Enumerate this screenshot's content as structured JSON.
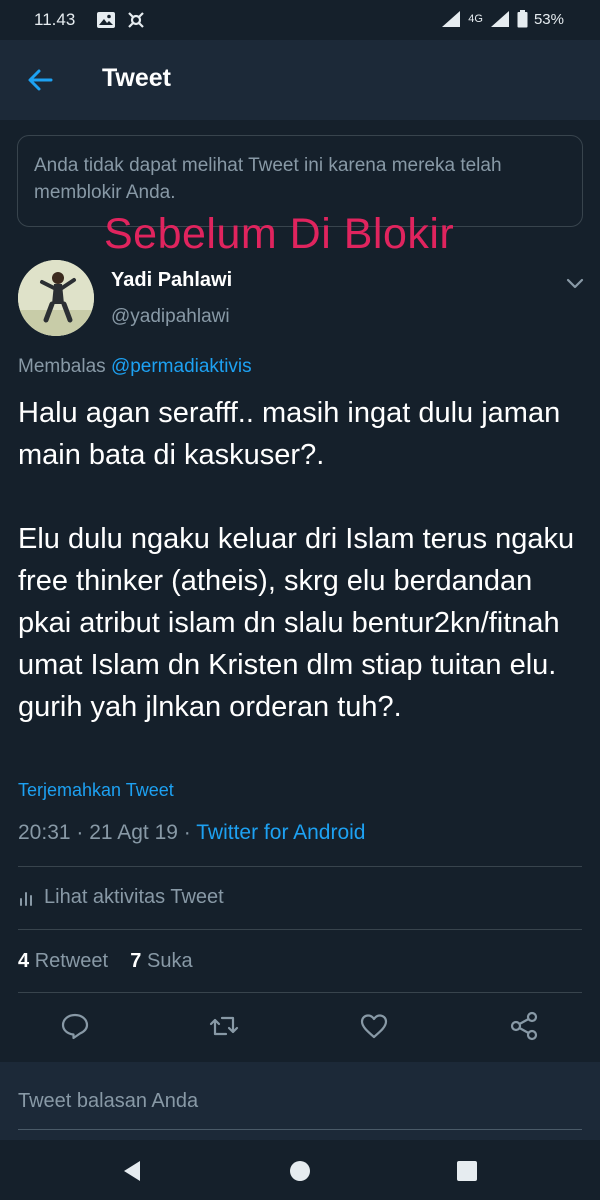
{
  "status_bar": {
    "time": "11.43",
    "network": "4G",
    "battery": "53%"
  },
  "app_bar": {
    "title": "Tweet"
  },
  "notice": {
    "text": "Anda tidak dapat melihat Tweet ini karena mereka telah memblokir Anda."
  },
  "overlay_caption": "Sebelum Di Blokir",
  "tweet": {
    "author_name": "Yadi Pahlawi",
    "author_handle": "@yadipahlawi",
    "replying_prefix": "Membalas",
    "replying_to": "@permadiaktivis",
    "body": "Halu agan serafff..  masih ingat dulu jaman main bata di kaskuser?.\n\nElu dulu ngaku keluar dri Islam terus ngaku free thinker (atheis), skrg elu berdandan pkai atribut islam dn slalu  bentur2kn/fitnah umat Islam dn Kristen dlm stiap tuitan elu. gurih yah jlnkan orderan tuh?.",
    "translate_label": "Terjemahkan Tweet",
    "time_date": "20:31 · 21 Agt 19 · ",
    "source": "Twitter for Android",
    "activity_label": "Lihat aktivitas Tweet",
    "retweet_count": "4",
    "retweet_label": "Retweet",
    "like_count": "7",
    "like_label": "Suka"
  },
  "reply_bar": {
    "placeholder": "Tweet balasan Anda"
  },
  "colors": {
    "background": "#15202b",
    "accent": "#1da1f2",
    "overlay": "#e0245e",
    "secondary_text": "#8899a6"
  },
  "icons": [
    "image-icon",
    "app-icon",
    "signal-icon",
    "battery-icon",
    "back-arrow-icon",
    "chevron-down-icon",
    "bar-chart-icon",
    "reply-icon",
    "retweet-icon",
    "like-icon",
    "share-icon",
    "nav-back-icon",
    "nav-home-icon",
    "nav-recents-icon"
  ]
}
